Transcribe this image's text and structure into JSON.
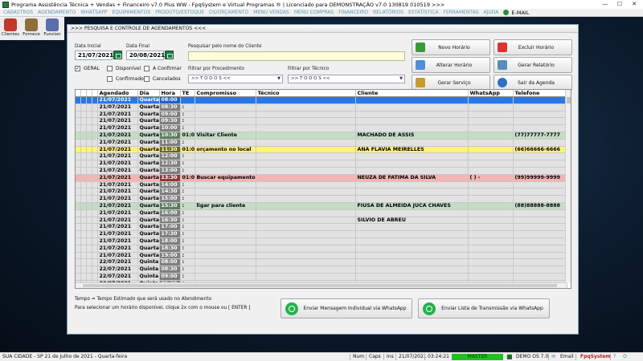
{
  "window": {
    "title": "Programa Assistência Técnica + Vendas + Financeiro v7.0 Plus WW - FpqSystem e Virtual Programas ® | Licenciado para  DEMONSTRAÇÃO v7.0 130819 010519 >>>",
    "min": "—",
    "max": "☐",
    "close": "✕"
  },
  "menu": {
    "items": [
      "CADASTROS",
      "AGENDAMENTO",
      "WHATSAPP",
      "EQUIPAMENTOS",
      "PRODUTO/ESTOQUE",
      "OS/ORÇAMENTO",
      "MENU VENDAS",
      "MENU COMPRAS",
      "FINANCEIRO",
      "RELATÓRIOS",
      "ESTATÍSTICA",
      "FERRAMENTAS",
      "AJUDA"
    ],
    "email": "E-MAIL",
    "item_color": "#5b9ab8"
  },
  "toolbar": {
    "items": [
      {
        "label": "Clientes",
        "icon": "clients-icon",
        "color": "#c0392b"
      },
      {
        "label": "Fornece",
        "icon": "supplier-icon",
        "color": "#8e6f3a"
      },
      {
        "label": "Funcion",
        "icon": "employee-icon",
        "color": "#5a6fa8"
      }
    ]
  },
  "dialog": {
    "title": ">>>  PESQUISA E CONTROLE DE AGENDAMENTOS  <<<",
    "date_start_label": "Data Inicial",
    "date_start": "21/07/2021",
    "date_end_label": "Data Final",
    "date_end": "20/08/2021",
    "search_label": "Pesquisar pelo nome do Cliente",
    "search_value": "",
    "proc_label": "Filtrar por Procedimento",
    "proc_value": ">> T O D O S <<",
    "tech_label": "Filtrar por Técnico",
    "tech_value": ">> T O D O S <<",
    "filters": {
      "geral": {
        "label": "GERAL",
        "checked": "✓"
      },
      "disponivel": "Disponível",
      "confirmado": "Confirmado",
      "a_confirmar": "A Confirmar",
      "cancelados": "Cancelados"
    },
    "buttons": {
      "novo": "Novo Horário",
      "excluir": "Excluir Horário",
      "alterar": "Alterar Horário",
      "relatorio": "Gerar Relatório",
      "servico": "Gerar  Serviço",
      "sair": "Sair da Agenda"
    },
    "note1": "Tempo = Tempo Estimado que será usado no Atendimento",
    "note2": "Para selecionar um horário disponível, clique 2x com o mouse ou [ ENTER ]",
    "whatsapp_individual": "Enviar Mensagem Individual via WhatsApp",
    "whatsapp_lista": "Enviar Lista de Transmissão via WhatsApp"
  },
  "grid": {
    "columns": [
      "Agendado",
      "Dia",
      "Hora",
      "TE",
      "Compromisso",
      "Técnico",
      "Cliente",
      "WhatsApp",
      "Telefone"
    ],
    "rows": [
      {
        "d": "21/07/2021",
        "dia": "Quarta",
        "h": "08:00",
        "te": "",
        "comp": "",
        "tec": "",
        "cli": "",
        "wa": "",
        "tel": "",
        "st": "selected"
      },
      {
        "d": "21/07/2021",
        "dia": "Quarta",
        "h": "08:30",
        "te": ":",
        "comp": "",
        "tec": "",
        "cli": "",
        "wa": "",
        "tel": "",
        "st": "dim"
      },
      {
        "d": "21/07/2021",
        "dia": "Quarta",
        "h": "09:00",
        "te": ":",
        "comp": "",
        "tec": "",
        "cli": "",
        "wa": "",
        "tel": "",
        "st": "dim"
      },
      {
        "d": "21/07/2021",
        "dia": "Quarta",
        "h": "09:30",
        "te": ":",
        "comp": "",
        "tec": "",
        "cli": "",
        "wa": "",
        "tel": "",
        "st": "dim"
      },
      {
        "d": "21/07/2021",
        "dia": "Quarta",
        "h": "10:00",
        "te": ":",
        "comp": "",
        "tec": "",
        "cli": "",
        "wa": "",
        "tel": "",
        "st": "dim"
      },
      {
        "d": "21/07/2021",
        "dia": "Quarta",
        "h": "10:30",
        "te": "01:00",
        "comp": "Visitar Cliente",
        "tec": "",
        "cli": "MACHADO DE ASSIS",
        "wa": "",
        "tel": "(77)77777-7777",
        "st": "green"
      },
      {
        "d": "21/07/2021",
        "dia": "Quarta",
        "h": "11:00",
        "te": ":",
        "comp": "",
        "tec": "",
        "cli": "",
        "wa": "",
        "tel": "",
        "st": "dim"
      },
      {
        "d": "21/07/2021",
        "dia": "Quarta",
        "h": "11:30",
        "te": "01:00",
        "comp": "orçamento no local",
        "tec": "",
        "cli": "ANA FLAVIA MEIRELLES",
        "wa": "",
        "tel": "(66)66666-6666",
        "st": "yellow"
      },
      {
        "d": "21/07/2021",
        "dia": "Quarta",
        "h": "12:00",
        "te": ":",
        "comp": "",
        "tec": "",
        "cli": "",
        "wa": "",
        "tel": "",
        "st": "dim"
      },
      {
        "d": "21/07/2021",
        "dia": "Quarta",
        "h": "12:30",
        "te": ":",
        "comp": "",
        "tec": "",
        "cli": "",
        "wa": "",
        "tel": "",
        "st": "dim"
      },
      {
        "d": "21/07/2021",
        "dia": "Quarta",
        "h": "13:00",
        "te": ":",
        "comp": "",
        "tec": "",
        "cli": "",
        "wa": "",
        "tel": "",
        "st": "dim"
      },
      {
        "d": "21/07/2021",
        "dia": "Quarta",
        "h": "13:30",
        "te": "01:00",
        "comp": "Buscar equipamento",
        "tec": "",
        "cli": "NEUZA DE FATIMA DA SILVA",
        "wa": "(   )     -",
        "tel": "(99)99999-9999",
        "st": "red"
      },
      {
        "d": "21/07/2021",
        "dia": "Quarta",
        "h": "14:00",
        "te": ":",
        "comp": "",
        "tec": "",
        "cli": "",
        "wa": "",
        "tel": "",
        "st": "dim"
      },
      {
        "d": "21/07/2021",
        "dia": "Quarta",
        "h": "14:30",
        "te": ":",
        "comp": "",
        "tec": "",
        "cli": "",
        "wa": "",
        "tel": "",
        "st": "dim"
      },
      {
        "d": "21/07/2021",
        "dia": "Quarta",
        "h": "15:00",
        "te": ":",
        "comp": "",
        "tec": "",
        "cli": "",
        "wa": "",
        "tel": "",
        "st": "dim"
      },
      {
        "d": "21/07/2021",
        "dia": "Quarta",
        "h": "15:30",
        "te": ":",
        "comp": "ligar para cliente",
        "tec": "",
        "cli": "FIUSA DE ALMEIDA JUCA CHAVES",
        "wa": "",
        "tel": "(88)88888-8888",
        "st": "green"
      },
      {
        "d": "21/07/2021",
        "dia": "Quarta",
        "h": "16:00",
        "te": ":",
        "comp": "",
        "tec": "",
        "cli": "",
        "wa": "",
        "tel": "",
        "st": "dim"
      },
      {
        "d": "21/07/2021",
        "dia": "Quarta",
        "h": "16:30",
        "te": ":",
        "comp": "",
        "tec": "",
        "cli": "SILVIO DE ABREU",
        "wa": "",
        "tel": "",
        "st": "dim"
      },
      {
        "d": "21/07/2021",
        "dia": "Quarta",
        "h": "17:00",
        "te": ":",
        "comp": "",
        "tec": "",
        "cli": "",
        "wa": "",
        "tel": "",
        "st": "dim"
      },
      {
        "d": "21/07/2021",
        "dia": "Quarta",
        "h": "17:30",
        "te": ":",
        "comp": "",
        "tec": "",
        "cli": "",
        "wa": "",
        "tel": "",
        "st": "dim"
      },
      {
        "d": "21/07/2021",
        "dia": "Quarta",
        "h": "18:00",
        "te": ":",
        "comp": "",
        "tec": "",
        "cli": "",
        "wa": "",
        "tel": "",
        "st": "dim"
      },
      {
        "d": "21/07/2021",
        "dia": "Quarta",
        "h": "18:30",
        "te": ":",
        "comp": "",
        "tec": "",
        "cli": "",
        "wa": "",
        "tel": "",
        "st": "dim"
      },
      {
        "d": "21/07/2021",
        "dia": "Quarta",
        "h": "19:00",
        "te": ":",
        "comp": "",
        "tec": "",
        "cli": "",
        "wa": "",
        "tel": "",
        "st": "dim"
      },
      {
        "d": "22/07/2021",
        "dia": "Quinta",
        "h": "08:00",
        "te": ":",
        "comp": "",
        "tec": "",
        "cli": "",
        "wa": "",
        "tel": "",
        "st": "dim"
      },
      {
        "d": "22/07/2021",
        "dia": "Quinta",
        "h": "08:30",
        "te": ":",
        "comp": "",
        "tec": "",
        "cli": "",
        "wa": "",
        "tel": "",
        "st": "dim"
      },
      {
        "d": "22/07/2021",
        "dia": "Quinta",
        "h": "09:00",
        "te": ":",
        "comp": "",
        "tec": "",
        "cli": "",
        "wa": "",
        "tel": "",
        "st": "dim"
      },
      {
        "d": "22/07/2021",
        "dia": "Quinta",
        "h": "09:30",
        "te": ":",
        "comp": "",
        "tec": "",
        "cli": "",
        "wa": "",
        "tel": "",
        "st": "dim"
      },
      {
        "d": "22/07/2021",
        "dia": "Quinta",
        "h": "10:00",
        "te": ":",
        "comp": "",
        "tec": "",
        "cli": "",
        "wa": "",
        "tel": "",
        "st": "dim"
      }
    ]
  },
  "statusbar": {
    "city": "SUA CIDADE - SP 21 de Julho de 2021 - Quarta-feira",
    "num": "Num",
    "caps": "Caps",
    "ins": "Ins",
    "date": "21/07/2021",
    "time": "03:24:21",
    "master": "MASTER",
    "version": "DEMO OS 7.0",
    "email": "Email",
    "brand": "FpqSystem",
    "brand_color": "#b01e1e"
  }
}
